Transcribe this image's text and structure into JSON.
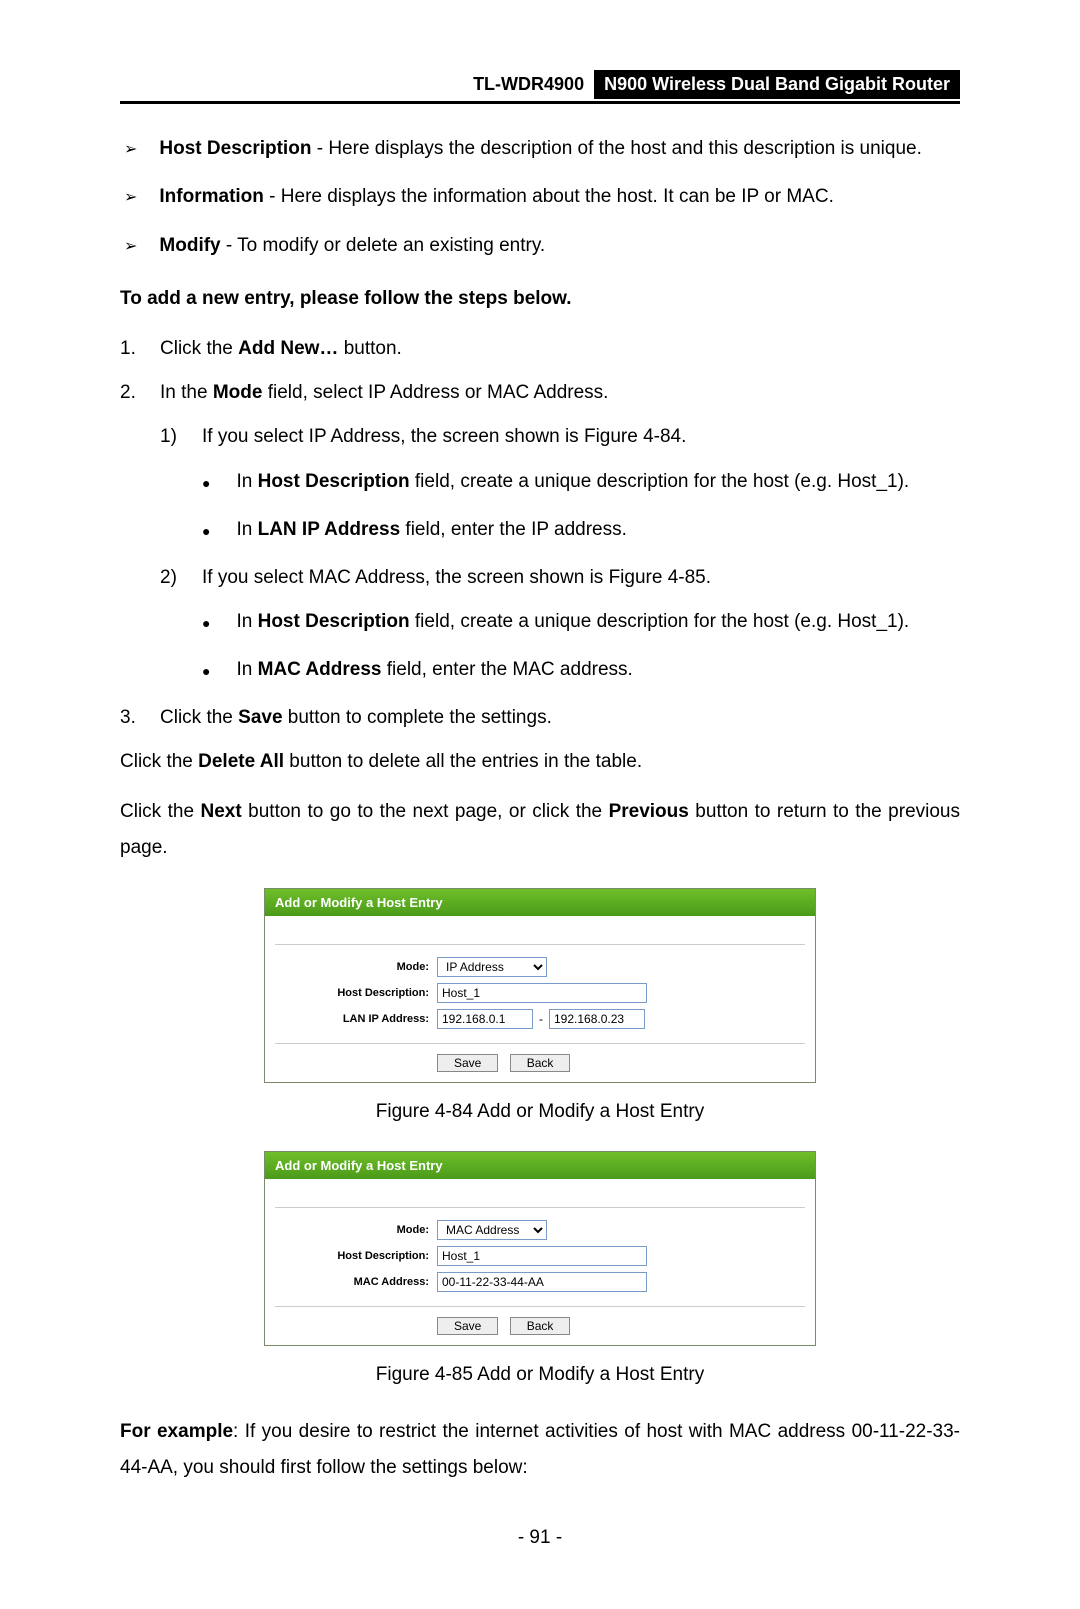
{
  "header": {
    "model": "TL-WDR4900",
    "title": "N900 Wireless Dual Band Gigabit Router"
  },
  "arrows": {
    "hostDesc": {
      "label": "Host Description",
      "text": " - Here displays the description of the host and this description is unique."
    },
    "information": {
      "label": "Information",
      "text": " - Here displays the information about the host. It can be IP or MAC."
    },
    "modify": {
      "label": "Modify",
      "text": " - To modify or delete an existing entry."
    }
  },
  "addNewHeading": "To add a new entry, please follow the steps below.",
  "steps": {
    "s1": {
      "num": "1.",
      "pre": "Click the ",
      "bold": "Add New…",
      "post": " button."
    },
    "s2": {
      "num": "2.",
      "pre": "In the ",
      "bold": "Mode",
      "post": " field, select IP Address or MAC Address."
    },
    "s2a": {
      "num": "1)",
      "text": "If you select IP Address, the screen shown is Figure 4-84."
    },
    "s2a_i": {
      "pre": "In ",
      "bold": "Host Description",
      "post": " field, create a unique description for the host (e.g. Host_1)."
    },
    "s2a_ii": {
      "pre": "In ",
      "bold": "LAN IP Address",
      "post": " field, enter the IP address."
    },
    "s2b": {
      "num": "2)",
      "text": "If you select MAC Address, the screen shown is Figure 4-85."
    },
    "s2b_i": {
      "pre": "In ",
      "bold": "Host Description",
      "post": " field, create a unique description for the host (e.g. Host_1)."
    },
    "s2b_ii": {
      "pre": "In ",
      "bold": "MAC Address",
      "post": " field, enter the MAC address."
    },
    "s3": {
      "num": "3.",
      "pre": "Click the ",
      "bold": "Save",
      "post": " button to complete the settings."
    }
  },
  "deleteAll": {
    "pre": "Click the ",
    "bold": "Delete All",
    "post": " button to delete all the entries in the table."
  },
  "nextPrev": {
    "pre": "Click the ",
    "b1": "Next",
    "mid": " button to go to the next page, or click the ",
    "b2": "Previous",
    "post": " button to return to the previous page."
  },
  "fig84": {
    "title": "Add or Modify a Host Entry",
    "modeLabel": "Mode:",
    "modeValue": "IP Address",
    "hostDescLabel": "Host Description:",
    "hostDescValue": "Host_1",
    "lanLabel": "LAN IP Address:",
    "lanFrom": "192.168.0.1",
    "lanTo": "192.168.0.23",
    "saveBtn": "Save",
    "backBtn": "Back",
    "caption": "Figure 4-84 Add or Modify a Host Entry"
  },
  "fig85": {
    "title": "Add or Modify a Host Entry",
    "modeLabel": "Mode:",
    "modeValue": "MAC Address",
    "hostDescLabel": "Host Description:",
    "hostDescValue": "Host_1",
    "macLabel": "MAC Address:",
    "macValue": "00-11-22-33-44-AA",
    "saveBtn": "Save",
    "backBtn": "Back",
    "caption": "Figure 4-85 Add or Modify a Host Entry"
  },
  "example": {
    "bold": "For example",
    "text": ": If you desire to restrict the internet activities of host with MAC address 00-11-22-33-44-AA, you should first follow the settings below:"
  },
  "pageNumber": "- 91 -"
}
